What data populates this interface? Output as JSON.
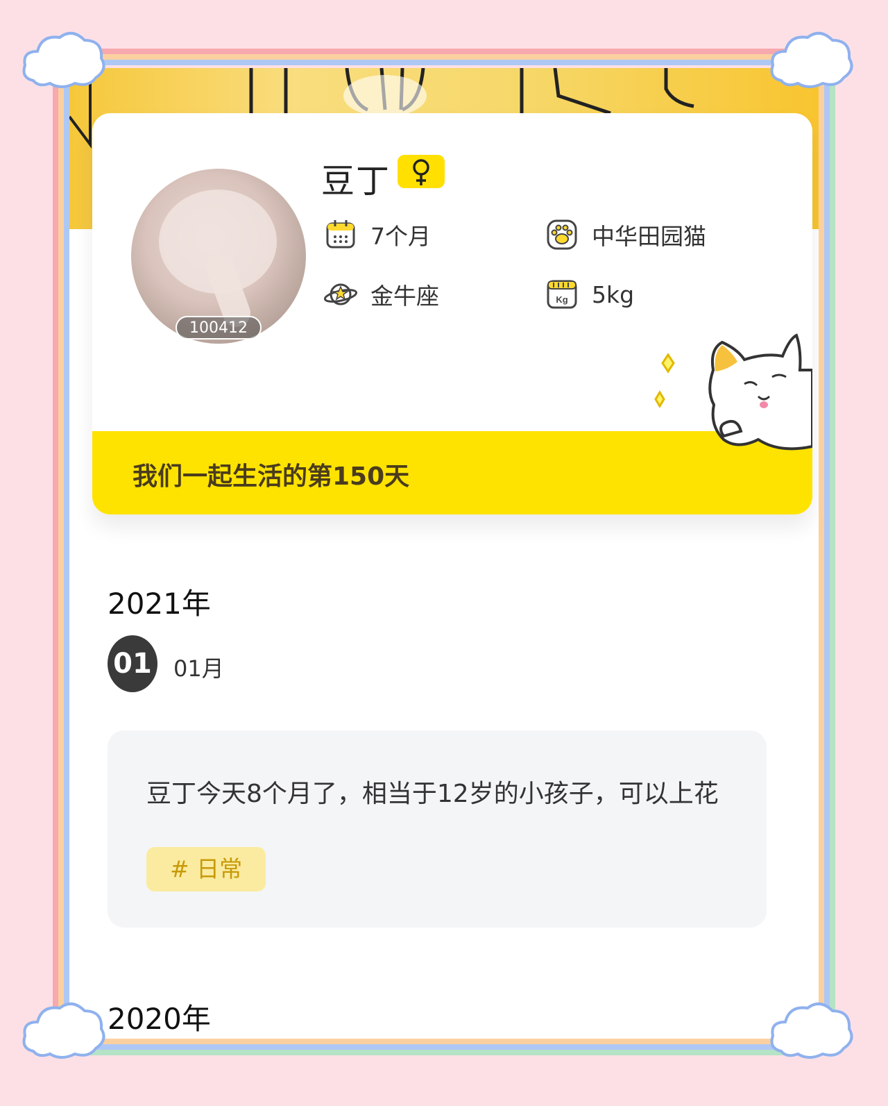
{
  "profile": {
    "name": "豆丁",
    "id": "100412",
    "age": "7个月",
    "breed": "中华田园猫",
    "zodiac": "金牛座",
    "weight": "5kg",
    "together": "我们一起生活的第150天"
  },
  "timeline": {
    "year1": "2021年",
    "month_badge": "01",
    "month_label": "01月",
    "post_text": "豆丁今天8个月了，相当于12岁的小孩子，可以上花",
    "post_tag": "# 日常",
    "year2": "2020年"
  },
  "icons": [
    "female-icon",
    "calendar-icon",
    "paw-icon",
    "planet-icon",
    "scale-icon",
    "cloud-icon"
  ],
  "colors": {
    "accent_yellow": "#ffe300",
    "frame_pink": "#f7a9ae",
    "frame_blue": "#aec8f5",
    "frame_green": "#b5e3c6",
    "frame_orange": "#fbd0a0",
    "background": "#fde0e6"
  }
}
